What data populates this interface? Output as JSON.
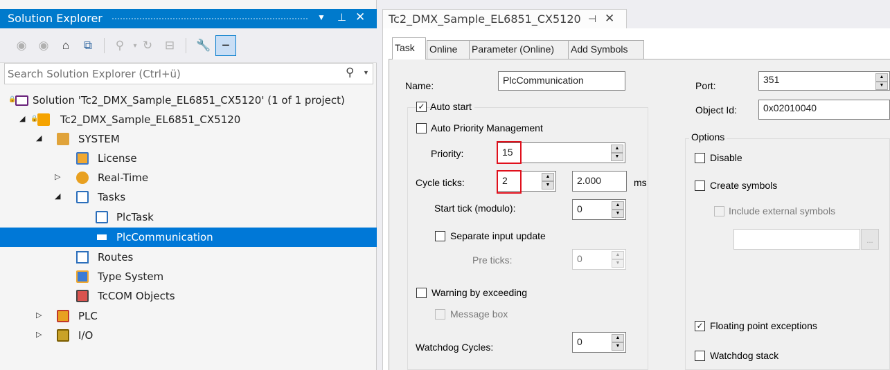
{
  "solution_explorer": {
    "title": "Solution Explorer",
    "search_placeholder": "Search Solution Explorer (Ctrl+ü)",
    "tree": [
      {
        "label": "Solution 'Tc2_DMX_Sample_EL6851_CX5120' (1 of 1 project)",
        "icon": "solution-icon"
      },
      {
        "label": "Tc2_DMX_Sample_EL6851_CX5120",
        "icon": "twincat-project-icon"
      },
      {
        "label": "SYSTEM",
        "icon": "system-icon"
      },
      {
        "label": "License",
        "icon": "license-icon"
      },
      {
        "label": "Real-Time",
        "icon": "realtime-icon"
      },
      {
        "label": "Tasks",
        "icon": "tasks-icon"
      },
      {
        "label": "PlcTask",
        "icon": "task-icon"
      },
      {
        "label": "PlcCommunication",
        "icon": "task-item-icon",
        "selected": true
      },
      {
        "label": "Routes",
        "icon": "routes-icon"
      },
      {
        "label": "Type System",
        "icon": "type-system-icon"
      },
      {
        "label": "TcCOM Objects",
        "icon": "tccom-icon"
      },
      {
        "label": "PLC",
        "icon": "plc-icon"
      },
      {
        "label": "I/O",
        "icon": "io-icon"
      }
    ]
  },
  "document_tab": {
    "title": "Tc2_DMX_Sample_EL6851_CX5120"
  },
  "inner_tabs": [
    "Task",
    "Online",
    "Parameter (Online)",
    "Add Symbols"
  ],
  "task": {
    "name_label": "Name:",
    "name_value": "PlcCommunication",
    "auto_start_label": "Auto start",
    "auto_start": true,
    "auto_priority_label": "Auto Priority Management",
    "auto_priority": false,
    "priority_label": "Priority:",
    "priority_value": "15",
    "cycle_ticks_label": "Cycle ticks:",
    "cycle_ticks_value": "2",
    "cycle_ms_value": "2.000",
    "ms_unit": "ms",
    "start_tick_label": "Start tick (modulo):",
    "start_tick_value": "0",
    "separate_input_label": "Separate input update",
    "pre_ticks_label": "Pre ticks:",
    "pre_ticks_value": "0",
    "warning_label": "Warning by exceeding",
    "message_box_label": "Message box",
    "watchdog_cycles_label": "Watchdog Cycles:",
    "watchdog_cycles_value": "0",
    "port_label": "Port:",
    "port_value": "351",
    "object_id_label": "Object Id:",
    "object_id_value": "0x02010040",
    "options_label": "Options",
    "disable_label": "Disable",
    "create_symbols_label": "Create symbols",
    "include_external_label": "Include external symbols",
    "browse_label": "...",
    "floating_point_label": "Floating point exceptions",
    "floating_point": true,
    "watchdog_stack_label": "Watchdog stack"
  },
  "colors": {
    "accent": "#007acc",
    "selection": "#0078d7",
    "highlight": "#e0101c"
  }
}
